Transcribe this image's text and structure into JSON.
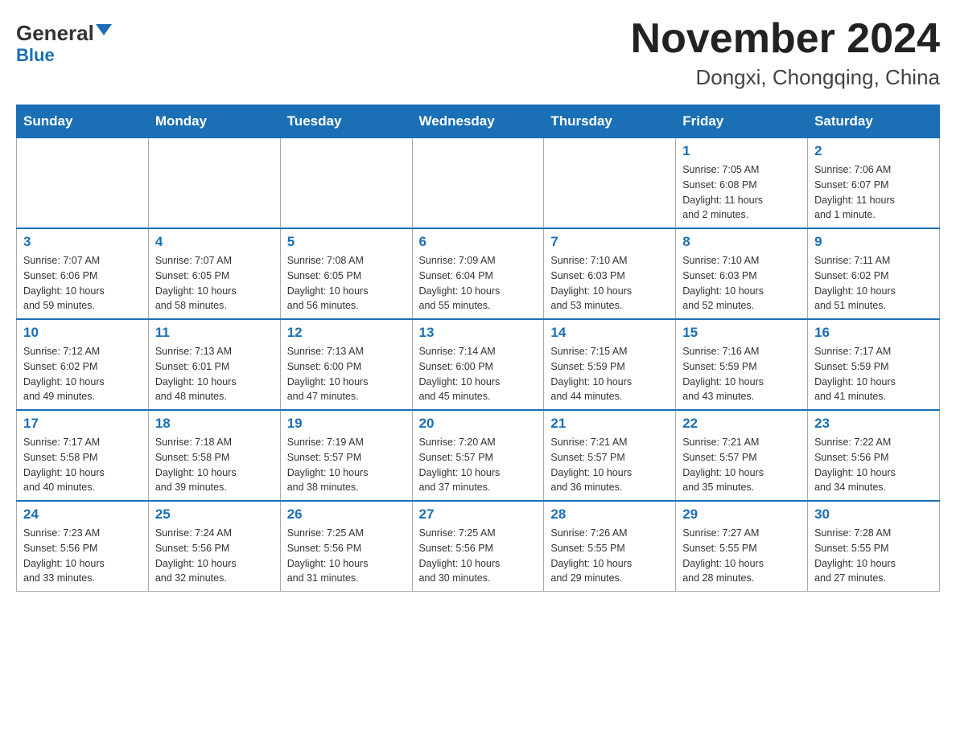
{
  "header": {
    "logo_general": "General",
    "logo_blue": "Blue",
    "title": "November 2024",
    "subtitle": "Dongxi, Chongqing, China"
  },
  "days_of_week": [
    "Sunday",
    "Monday",
    "Tuesday",
    "Wednesday",
    "Thursday",
    "Friday",
    "Saturday"
  ],
  "weeks": [
    [
      {
        "day": "",
        "info": ""
      },
      {
        "day": "",
        "info": ""
      },
      {
        "day": "",
        "info": ""
      },
      {
        "day": "",
        "info": ""
      },
      {
        "day": "",
        "info": ""
      },
      {
        "day": "1",
        "info": "Sunrise: 7:05 AM\nSunset: 6:08 PM\nDaylight: 11 hours\nand 2 minutes."
      },
      {
        "day": "2",
        "info": "Sunrise: 7:06 AM\nSunset: 6:07 PM\nDaylight: 11 hours\nand 1 minute."
      }
    ],
    [
      {
        "day": "3",
        "info": "Sunrise: 7:07 AM\nSunset: 6:06 PM\nDaylight: 10 hours\nand 59 minutes."
      },
      {
        "day": "4",
        "info": "Sunrise: 7:07 AM\nSunset: 6:05 PM\nDaylight: 10 hours\nand 58 minutes."
      },
      {
        "day": "5",
        "info": "Sunrise: 7:08 AM\nSunset: 6:05 PM\nDaylight: 10 hours\nand 56 minutes."
      },
      {
        "day": "6",
        "info": "Sunrise: 7:09 AM\nSunset: 6:04 PM\nDaylight: 10 hours\nand 55 minutes."
      },
      {
        "day": "7",
        "info": "Sunrise: 7:10 AM\nSunset: 6:03 PM\nDaylight: 10 hours\nand 53 minutes."
      },
      {
        "day": "8",
        "info": "Sunrise: 7:10 AM\nSunset: 6:03 PM\nDaylight: 10 hours\nand 52 minutes."
      },
      {
        "day": "9",
        "info": "Sunrise: 7:11 AM\nSunset: 6:02 PM\nDaylight: 10 hours\nand 51 minutes."
      }
    ],
    [
      {
        "day": "10",
        "info": "Sunrise: 7:12 AM\nSunset: 6:02 PM\nDaylight: 10 hours\nand 49 minutes."
      },
      {
        "day": "11",
        "info": "Sunrise: 7:13 AM\nSunset: 6:01 PM\nDaylight: 10 hours\nand 48 minutes."
      },
      {
        "day": "12",
        "info": "Sunrise: 7:13 AM\nSunset: 6:00 PM\nDaylight: 10 hours\nand 47 minutes."
      },
      {
        "day": "13",
        "info": "Sunrise: 7:14 AM\nSunset: 6:00 PM\nDaylight: 10 hours\nand 45 minutes."
      },
      {
        "day": "14",
        "info": "Sunrise: 7:15 AM\nSunset: 5:59 PM\nDaylight: 10 hours\nand 44 minutes."
      },
      {
        "day": "15",
        "info": "Sunrise: 7:16 AM\nSunset: 5:59 PM\nDaylight: 10 hours\nand 43 minutes."
      },
      {
        "day": "16",
        "info": "Sunrise: 7:17 AM\nSunset: 5:59 PM\nDaylight: 10 hours\nand 41 minutes."
      }
    ],
    [
      {
        "day": "17",
        "info": "Sunrise: 7:17 AM\nSunset: 5:58 PM\nDaylight: 10 hours\nand 40 minutes."
      },
      {
        "day": "18",
        "info": "Sunrise: 7:18 AM\nSunset: 5:58 PM\nDaylight: 10 hours\nand 39 minutes."
      },
      {
        "day": "19",
        "info": "Sunrise: 7:19 AM\nSunset: 5:57 PM\nDaylight: 10 hours\nand 38 minutes."
      },
      {
        "day": "20",
        "info": "Sunrise: 7:20 AM\nSunset: 5:57 PM\nDaylight: 10 hours\nand 37 minutes."
      },
      {
        "day": "21",
        "info": "Sunrise: 7:21 AM\nSunset: 5:57 PM\nDaylight: 10 hours\nand 36 minutes."
      },
      {
        "day": "22",
        "info": "Sunrise: 7:21 AM\nSunset: 5:57 PM\nDaylight: 10 hours\nand 35 minutes."
      },
      {
        "day": "23",
        "info": "Sunrise: 7:22 AM\nSunset: 5:56 PM\nDaylight: 10 hours\nand 34 minutes."
      }
    ],
    [
      {
        "day": "24",
        "info": "Sunrise: 7:23 AM\nSunset: 5:56 PM\nDaylight: 10 hours\nand 33 minutes."
      },
      {
        "day": "25",
        "info": "Sunrise: 7:24 AM\nSunset: 5:56 PM\nDaylight: 10 hours\nand 32 minutes."
      },
      {
        "day": "26",
        "info": "Sunrise: 7:25 AM\nSunset: 5:56 PM\nDaylight: 10 hours\nand 31 minutes."
      },
      {
        "day": "27",
        "info": "Sunrise: 7:25 AM\nSunset: 5:56 PM\nDaylight: 10 hours\nand 30 minutes."
      },
      {
        "day": "28",
        "info": "Sunrise: 7:26 AM\nSunset: 5:55 PM\nDaylight: 10 hours\nand 29 minutes."
      },
      {
        "day": "29",
        "info": "Sunrise: 7:27 AM\nSunset: 5:55 PM\nDaylight: 10 hours\nand 28 minutes."
      },
      {
        "day": "30",
        "info": "Sunrise: 7:28 AM\nSunset: 5:55 PM\nDaylight: 10 hours\nand 27 minutes."
      }
    ]
  ]
}
